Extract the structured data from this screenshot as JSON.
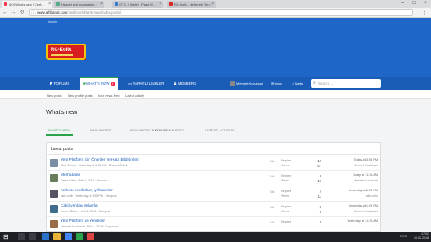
{
  "browser": {
    "tabs": [
      {
        "label": "(10) What's new | Xenf..."
      },
      {
        "label": "Header and navigation..."
      },
      {
        "label": "GTC 3 (Beta) | Page 33 ..."
      },
      {
        "label": "RC-Kolik - değerlekt Yen..."
      }
    ],
    "url_host": "www.alfibanal.com",
    "url_path": "/xenforo/what-is-new/index-posts/"
  },
  "site": {
    "admin_label": "Admin",
    "logo_text": "RC-Kolik",
    "nav": {
      "forums": "FORUMS",
      "whats_new": "WHAT'S NEW",
      "whats_new_badge": "1",
      "yararli": "YARARLI LINKLER",
      "members": "MEMBERS",
      "user_name": "Mehmet Kucuksari",
      "inbox": "Inbox",
      "inbox_badge": "10",
      "alerts": "Alerts",
      "search_placeholder": "Search..."
    },
    "subnav": [
      "New posts",
      "New profile posts",
      "Your news feed",
      "Latest activity"
    ]
  },
  "page": {
    "title": "What's new",
    "tabs": [
      "WHAT'S NEW",
      "NEW POSTS",
      "NEW PROFILE POSTS",
      "YOUR NEWS FEED",
      "LATEST ACTIVITY"
    ],
    "panel_title": "Latest posts",
    "rows": [
      {
        "title": "Yeni Platform için Öneriler ve Hata Bildirimleri",
        "meta": "Blue Sleeps · Yesterday at 6:58 PM · Discontl Estell",
        "action": "Edit",
        "replies": "12",
        "views": "47",
        "when": "Today at 3:58 PM",
        "who": "Mehmet Kucuksari"
      },
      {
        "title": "Merhabalar",
        "meta": "Ömer Erkan · Feb 9, 2018 · Tanışma",
        "action": "Edit",
        "replies": "3",
        "views": "19",
        "when": "Today at 11:36 AM",
        "who": "Mehmet Kucuksari"
      },
      {
        "title": "herkese merhabar, iyi forumlar",
        "meta": "fatih.cetin · Yesterday at 3:55 PM · Tanışma",
        "action": "Edit",
        "replies": "2",
        "views": "11",
        "when": "Yesterday at 6:53 PM",
        "who": "fatih.cetin"
      },
      {
        "title": "Cakiriyimdan selamlar",
        "meta": "Kerem Özbek · Feb 5, 2018 · Tanışma",
        "action": "Edit",
        "replies": "3",
        "views": "9",
        "when": "Yesterday at 1:09 PM",
        "who": "Mehmet Kucuksari"
      },
      {
        "title": "Yeni Platform ve Yenilikler",
        "meta": "Mehmet Kucuksari · Feb 4, 2018 · Duyurular",
        "action": "Edit",
        "replies": "3",
        "views": "",
        "when": "Yesterday at 11:35 AM",
        "who": ""
      }
    ],
    "labels": {
      "replies": "Replies",
      "views": "Views"
    }
  },
  "taskbar": {
    "lang": "ENG",
    "time": "17:02",
    "date": "16.02.2018"
  },
  "colors": {
    "header_blue": "#1e66c8",
    "accent_green": "#2aa34a"
  }
}
